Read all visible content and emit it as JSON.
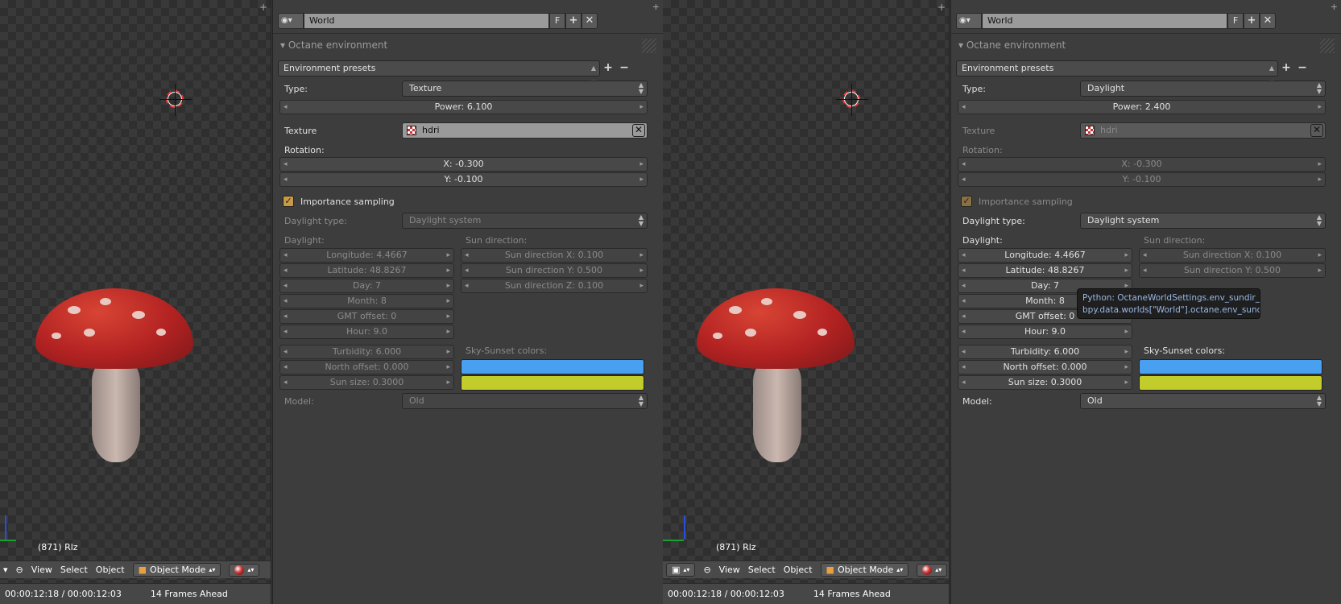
{
  "left": {
    "viewport": {
      "object_label": "(871) Rlz",
      "header": {
        "view": "View",
        "select": "Select",
        "object": "Object",
        "mode": "Object Mode"
      },
      "timeline": {
        "time": "00:00:12:18 / 00:00:12:03",
        "frames": "14 Frames Ahead"
      }
    },
    "panel": {
      "world_name": "World",
      "f_label": "F",
      "section_title": "Octane environment",
      "presets_label": "Environment presets",
      "type_label": "Type:",
      "type_value": "Texture",
      "power": "Power: 6.100",
      "texture_label": "Texture",
      "texture_value": "hdri",
      "rotation_label": "Rotation:",
      "rot_x": "X: -0.300",
      "rot_y": "Y: -0.100",
      "importance_label": "Importance sampling",
      "daylight_type_label": "Daylight type:",
      "daylight_type_value": "Daylight system",
      "daylight_label": "Daylight:",
      "sun_direction_label": "Sun direction:",
      "longitude": "Longitude: 4.4667",
      "latitude": "Latitude: 48.8267",
      "day": "Day: 7",
      "month": "Month: 8",
      "gmt": "GMT offset: 0",
      "hour": "Hour: 9.0",
      "sun_x": "Sun direction X: 0.100",
      "sun_y": "Sun direction Y: 0.500",
      "sun_z": "Sun direction Z: 0.100",
      "turbidity": "Turbidity: 6.000",
      "north_offset": "North offset: 0.000",
      "sun_size": "Sun size: 0.3000",
      "sky_colors_label": "Sky-Sunset colors:",
      "model_label": "Model:",
      "model_value": "Old"
    }
  },
  "right": {
    "viewport": {
      "object_label": "(871) Rlz",
      "header": {
        "view": "View",
        "select": "Select",
        "object": "Object",
        "mode": "Object Mode"
      },
      "timeline": {
        "time": "00:00:12:18 / 00:00:12:03",
        "frames": "14 Frames Ahead"
      }
    },
    "panel": {
      "world_name": "World",
      "f_label": "F",
      "section_title": "Octane environment",
      "presets_label": "Environment presets",
      "type_label": "Type:",
      "type_value": "Daylight",
      "power": "Power: 2.400",
      "texture_label": "Texture",
      "texture_value": "hdri",
      "rotation_label": "Rotation:",
      "rot_x": "X: -0.300",
      "rot_y": "Y: -0.100",
      "importance_label": "Importance sampling",
      "daylight_type_label": "Daylight type:",
      "daylight_type_value": "Daylight system",
      "daylight_label": "Daylight:",
      "sun_direction_label": "Sun direction:",
      "longitude": "Longitude: 4.4667",
      "latitude": "Latitude: 48.8267",
      "day": "Day: 7",
      "month": "Month: 8",
      "gmt": "GMT offset: 0",
      "hour": "Hour: 9.0",
      "sun_x": "Sun direction X: 0.100",
      "sun_y": "Sun direction Y: 0.500",
      "turbidity": "Turbidity: 6.000",
      "north_offset": "North offset: 0.000",
      "sun_size": "Sun size: 0.3000",
      "sky_colors_label": "Sky-Sunset colors:",
      "model_label": "Model:",
      "model_value": "Old"
    },
    "tooltip": {
      "line1": "Python: OctaneWorldSettings.env_sundir_y",
      "line2": "bpy.data.worlds[\"World\"].octane.env_sundir_y"
    }
  },
  "colors": {
    "sky_color": "#4aa0f0",
    "sunset_color": "#c2cc2a",
    "checkbox": "#c99a44",
    "mushroom_cap": "#c0302a"
  }
}
